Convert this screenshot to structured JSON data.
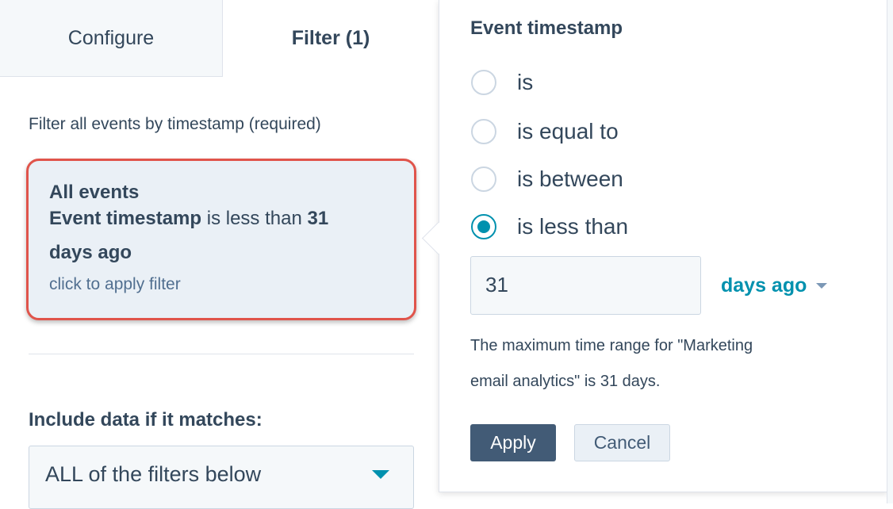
{
  "tabs": {
    "configure": "Configure",
    "filter": "Filter (1)"
  },
  "left": {
    "description": "Filter all events by timestamp (required)",
    "card": {
      "title": "All events",
      "property": "Event timestamp",
      "operator": " is less than ",
      "value": "31",
      "unit": "days ago",
      "hint": "click to apply filter"
    },
    "include_label": "Include data if it matches:",
    "include_select": "ALL of the filters below"
  },
  "popover": {
    "title": "Event timestamp",
    "options": [
      {
        "label": "is",
        "selected": false
      },
      {
        "label": "is equal to",
        "selected": false
      },
      {
        "label": "is between",
        "selected": false
      },
      {
        "label": "is less than",
        "selected": true
      }
    ],
    "value": "31",
    "unit": "days ago",
    "help1": "The maximum time range for \"Marketing",
    "help2": "email analytics\" is 31 days.",
    "apply": "Apply",
    "cancel": "Cancel"
  },
  "colors": {
    "accent": "#0091ae",
    "highlight": "#e0544b",
    "primary_button": "#425b76"
  }
}
